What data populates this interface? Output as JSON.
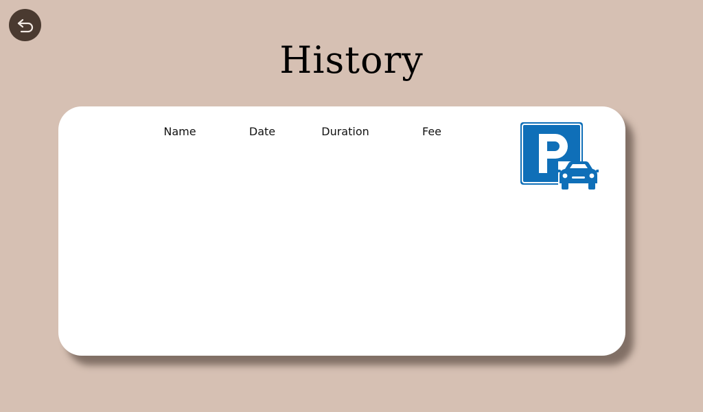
{
  "header": {
    "title": "History"
  },
  "table": {
    "columns": [
      "Name",
      "Date",
      "Duration",
      "Fee"
    ],
    "rows": []
  },
  "icons": {
    "back": "back-arrow-icon",
    "parking": "parking-sign-icon"
  },
  "colors": {
    "background": "#d6c0b3",
    "back_button": "#4a3a30",
    "card": "#ffffff",
    "parking_blue": "#0f6fb8"
  }
}
